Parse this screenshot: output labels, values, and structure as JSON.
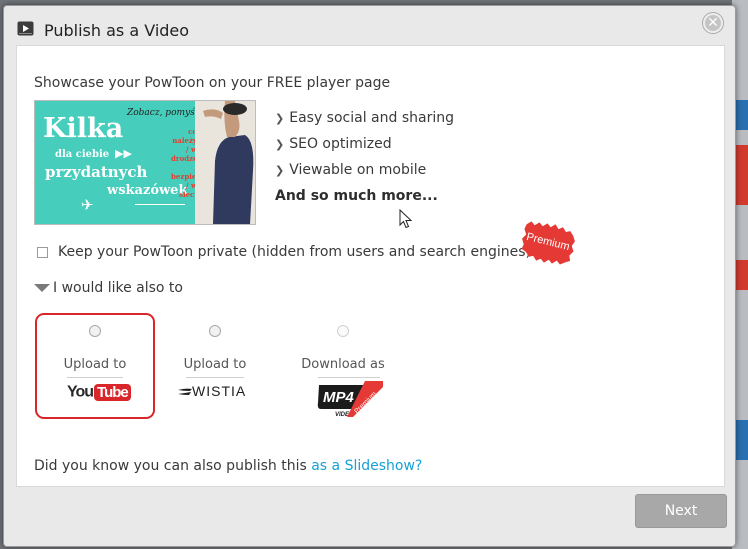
{
  "dialog": {
    "title": "Publish as a Video",
    "close_label": "✕"
  },
  "intro_text": "Showcase your PowToon on your FREE player page",
  "thumbnail": {
    "headline": "Kilka",
    "line2": "dla ciebie",
    "line3": "przydatnych",
    "line4": "wskazówek",
    "corner_text": "Zobacz, pomyś",
    "side_text": "co należy / w drodze / bezpieczeństw / w sieci"
  },
  "features": [
    "Easy social and sharing",
    "SEO optimized",
    "Viewable on mobile"
  ],
  "features_more": "And so much more...",
  "private_label": "Keep your PowToon private (hidden from users and search engines)",
  "premium_badge": "Premium",
  "also_label": "I would like also to",
  "options": [
    {
      "label": "Upload to",
      "logo": "YouTube",
      "logo_part1": "You",
      "logo_part2": "Tube",
      "selected": true
    },
    {
      "label": "Upload to",
      "logo": "WISTIA",
      "selected": false
    },
    {
      "label": "Download as",
      "logo": "MP4",
      "logo_sub": "VIDEO",
      "badge": "Premium",
      "selected": false
    }
  ],
  "footer": {
    "question": "Did you know you can also publish this ",
    "link": "as a Slideshow?"
  },
  "next_label": "Next",
  "colors": {
    "accent_red": "#d8262a",
    "link_blue": "#1aa0d6",
    "thumb_teal": "#47cdbc"
  }
}
